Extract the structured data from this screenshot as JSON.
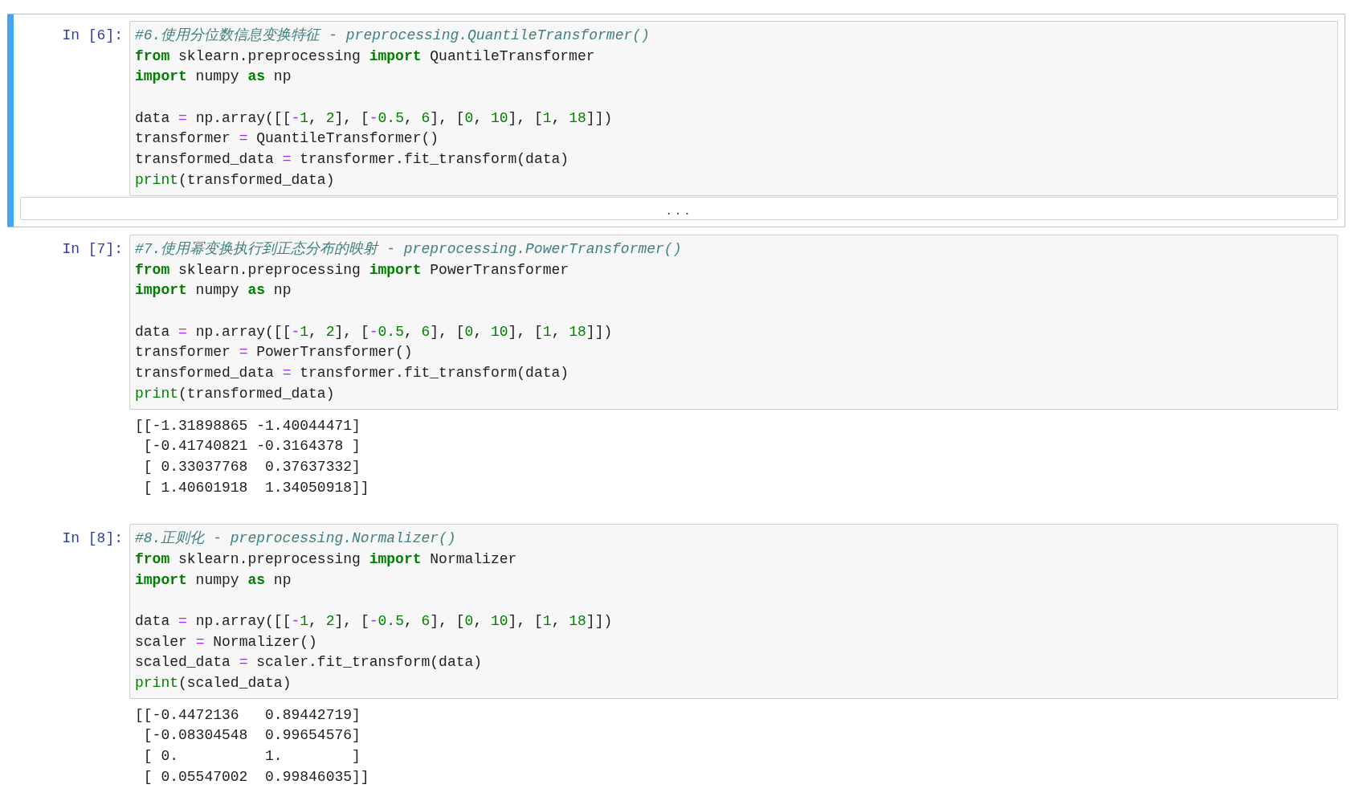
{
  "cells": [
    {
      "prompt": "In [6]:",
      "selected": true,
      "code": [
        [
          {
            "kind": "comment",
            "text": "#6.使用分位数信息变换特征 - preprocessing.QuantileTransformer()"
          }
        ],
        [
          {
            "kind": "kw",
            "text": "from"
          },
          {
            "kind": "plain",
            "text": " sklearn.preprocessing "
          },
          {
            "kind": "kw",
            "text": "import"
          },
          {
            "kind": "plain",
            "text": " QuantileTransformer"
          }
        ],
        [
          {
            "kind": "kw",
            "text": "import"
          },
          {
            "kind": "plain",
            "text": " numpy "
          },
          {
            "kind": "kw",
            "text": "as"
          },
          {
            "kind": "plain",
            "text": " np"
          }
        ],
        [
          {
            "kind": "blank"
          }
        ],
        [
          {
            "kind": "plain",
            "text": "data "
          },
          {
            "kind": "op",
            "text": "="
          },
          {
            "kind": "plain",
            "text": " np.array([["
          },
          {
            "kind": "op",
            "text": "-"
          },
          {
            "kind": "num",
            "text": "1"
          },
          {
            "kind": "plain",
            "text": ", "
          },
          {
            "kind": "num",
            "text": "2"
          },
          {
            "kind": "plain",
            "text": "], ["
          },
          {
            "kind": "op",
            "text": "-"
          },
          {
            "kind": "num",
            "text": "0.5"
          },
          {
            "kind": "plain",
            "text": ", "
          },
          {
            "kind": "num",
            "text": "6"
          },
          {
            "kind": "plain",
            "text": "], ["
          },
          {
            "kind": "num",
            "text": "0"
          },
          {
            "kind": "plain",
            "text": ", "
          },
          {
            "kind": "num",
            "text": "10"
          },
          {
            "kind": "plain",
            "text": "], ["
          },
          {
            "kind": "num",
            "text": "1"
          },
          {
            "kind": "plain",
            "text": ", "
          },
          {
            "kind": "num",
            "text": "18"
          },
          {
            "kind": "plain",
            "text": "]])"
          }
        ],
        [
          {
            "kind": "plain",
            "text": "transformer "
          },
          {
            "kind": "op",
            "text": "="
          },
          {
            "kind": "plain",
            "text": " QuantileTransformer()"
          }
        ],
        [
          {
            "kind": "plain",
            "text": "transformed_data "
          },
          {
            "kind": "op",
            "text": "="
          },
          {
            "kind": "plain",
            "text": " transformer.fit_transform(data)"
          }
        ],
        [
          {
            "kind": "builtin",
            "text": "print"
          },
          {
            "kind": "plain",
            "text": "(transformed_data)"
          }
        ]
      ],
      "output": {
        "kind": "collapsed",
        "text": "..."
      }
    },
    {
      "prompt": "In [7]:",
      "selected": false,
      "code": [
        [
          {
            "kind": "comment",
            "text": "#7.使用幂变换执行到正态分布的映射 - preprocessing.PowerTransformer()"
          }
        ],
        [
          {
            "kind": "kw",
            "text": "from"
          },
          {
            "kind": "plain",
            "text": " sklearn.preprocessing "
          },
          {
            "kind": "kw",
            "text": "import"
          },
          {
            "kind": "plain",
            "text": " PowerTransformer"
          }
        ],
        [
          {
            "kind": "kw",
            "text": "import"
          },
          {
            "kind": "plain",
            "text": " numpy "
          },
          {
            "kind": "kw",
            "text": "as"
          },
          {
            "kind": "plain",
            "text": " np"
          }
        ],
        [
          {
            "kind": "blank"
          }
        ],
        [
          {
            "kind": "plain",
            "text": "data "
          },
          {
            "kind": "op",
            "text": "="
          },
          {
            "kind": "plain",
            "text": " np.array([["
          },
          {
            "kind": "op",
            "text": "-"
          },
          {
            "kind": "num",
            "text": "1"
          },
          {
            "kind": "plain",
            "text": ", "
          },
          {
            "kind": "num",
            "text": "2"
          },
          {
            "kind": "plain",
            "text": "], ["
          },
          {
            "kind": "op",
            "text": "-"
          },
          {
            "kind": "num",
            "text": "0.5"
          },
          {
            "kind": "plain",
            "text": ", "
          },
          {
            "kind": "num",
            "text": "6"
          },
          {
            "kind": "plain",
            "text": "], ["
          },
          {
            "kind": "num",
            "text": "0"
          },
          {
            "kind": "plain",
            "text": ", "
          },
          {
            "kind": "num",
            "text": "10"
          },
          {
            "kind": "plain",
            "text": "], ["
          },
          {
            "kind": "num",
            "text": "1"
          },
          {
            "kind": "plain",
            "text": ", "
          },
          {
            "kind": "num",
            "text": "18"
          },
          {
            "kind": "plain",
            "text": "]])"
          }
        ],
        [
          {
            "kind": "plain",
            "text": "transformer "
          },
          {
            "kind": "op",
            "text": "="
          },
          {
            "kind": "plain",
            "text": " PowerTransformer()"
          }
        ],
        [
          {
            "kind": "plain",
            "text": "transformed_data "
          },
          {
            "kind": "op",
            "text": "="
          },
          {
            "kind": "plain",
            "text": " transformer.fit_transform(data)"
          }
        ],
        [
          {
            "kind": "builtin",
            "text": "print"
          },
          {
            "kind": "plain",
            "text": "(transformed_data)"
          }
        ]
      ],
      "output": {
        "kind": "stream",
        "lines": [
          "[[-1.31898865 -1.40044471]",
          " [-0.41740821 -0.3164378 ]",
          " [ 0.33037768  0.37637332]",
          " [ 1.40601918  1.34050918]]"
        ]
      }
    },
    {
      "prompt": "In [8]:",
      "selected": false,
      "code": [
        [
          {
            "kind": "comment",
            "text": "#8.正则化 - preprocessing.Normalizer()"
          }
        ],
        [
          {
            "kind": "kw",
            "text": "from"
          },
          {
            "kind": "plain",
            "text": " sklearn.preprocessing "
          },
          {
            "kind": "kw",
            "text": "import"
          },
          {
            "kind": "plain",
            "text": " Normalizer"
          }
        ],
        [
          {
            "kind": "kw",
            "text": "import"
          },
          {
            "kind": "plain",
            "text": " numpy "
          },
          {
            "kind": "kw",
            "text": "as"
          },
          {
            "kind": "plain",
            "text": " np"
          }
        ],
        [
          {
            "kind": "blank"
          }
        ],
        [
          {
            "kind": "plain",
            "text": "data "
          },
          {
            "kind": "op",
            "text": "="
          },
          {
            "kind": "plain",
            "text": " np.array([["
          },
          {
            "kind": "op",
            "text": "-"
          },
          {
            "kind": "num",
            "text": "1"
          },
          {
            "kind": "plain",
            "text": ", "
          },
          {
            "kind": "num",
            "text": "2"
          },
          {
            "kind": "plain",
            "text": "], ["
          },
          {
            "kind": "op",
            "text": "-"
          },
          {
            "kind": "num",
            "text": "0.5"
          },
          {
            "kind": "plain",
            "text": ", "
          },
          {
            "kind": "num",
            "text": "6"
          },
          {
            "kind": "plain",
            "text": "], ["
          },
          {
            "kind": "num",
            "text": "0"
          },
          {
            "kind": "plain",
            "text": ", "
          },
          {
            "kind": "num",
            "text": "10"
          },
          {
            "kind": "plain",
            "text": "], ["
          },
          {
            "kind": "num",
            "text": "1"
          },
          {
            "kind": "plain",
            "text": ", "
          },
          {
            "kind": "num",
            "text": "18"
          },
          {
            "kind": "plain",
            "text": "]])"
          }
        ],
        [
          {
            "kind": "plain",
            "text": "scaler "
          },
          {
            "kind": "op",
            "text": "="
          },
          {
            "kind": "plain",
            "text": " Normalizer()"
          }
        ],
        [
          {
            "kind": "plain",
            "text": "scaled_data "
          },
          {
            "kind": "op",
            "text": "="
          },
          {
            "kind": "plain",
            "text": " scaler.fit_transform(data)"
          }
        ],
        [
          {
            "kind": "builtin",
            "text": "print"
          },
          {
            "kind": "plain",
            "text": "(scaled_data)"
          }
        ]
      ],
      "output": {
        "kind": "stream",
        "lines": [
          "[[-0.4472136   0.89442719]",
          " [-0.08304548  0.99654576]",
          " [ 0.          1.        ]",
          " [ 0.05547002  0.99846035]]"
        ]
      }
    }
  ]
}
